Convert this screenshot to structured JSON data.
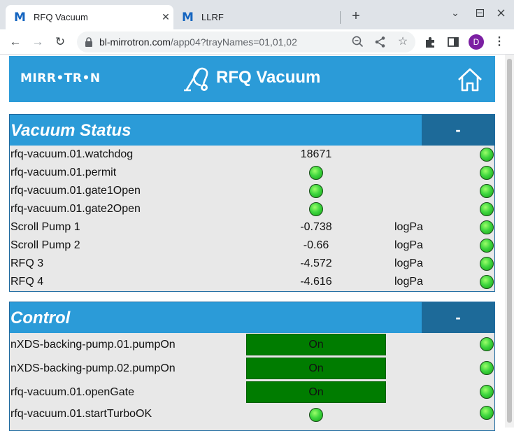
{
  "browser": {
    "tabs": [
      {
        "icon": "M",
        "title": "RFQ Vacuum",
        "active": true,
        "close": "✕"
      },
      {
        "icon": "M",
        "title": "LLRF",
        "active": false,
        "close": ""
      }
    ],
    "new_tab": "+",
    "url_host": "bl-mirrotron.com",
    "url_path": "/app04?trayNames=01,01,02",
    "profile_initial": "D"
  },
  "header": {
    "logo": "MIRR•TR•N",
    "title": "RFQ Vacuum"
  },
  "vacuum_status": {
    "title": "Vacuum Status",
    "toggle": "-",
    "rows": [
      {
        "label": "rfq-vacuum.01.watchdog",
        "value": "18671",
        "unit": ""
      },
      {
        "label": "rfq-vacuum.01.permit",
        "value": "",
        "unit": ""
      },
      {
        "label": "rfq-vacuum.01.gate1Open",
        "value": "",
        "unit": ""
      },
      {
        "label": "rfq-vacuum.01.gate2Open",
        "value": "",
        "unit": ""
      },
      {
        "label": "Scroll Pump 1",
        "value": "-0.738",
        "unit": "logPa"
      },
      {
        "label": "Scroll Pump 2",
        "value": "-0.66",
        "unit": "logPa"
      },
      {
        "label": "RFQ 3",
        "value": "-4.572",
        "unit": "logPa"
      },
      {
        "label": "RFQ 4",
        "value": "-4.616",
        "unit": "logPa"
      }
    ]
  },
  "control": {
    "title": "Control",
    "toggle": "-",
    "rows": [
      {
        "label": "nXDS-backing-pump.01.pumpOn",
        "button": "On"
      },
      {
        "label": "nXDS-backing-pump.02.pumpOn",
        "button": "On"
      },
      {
        "label": "rfq-vacuum.01.openGate",
        "button": "On"
      },
      {
        "label": "rfq-vacuum.01.startTurboOK",
        "button": ""
      }
    ]
  },
  "colors": {
    "accent": "#2b9bd8",
    "toggle_bg": "#1d6a99",
    "led_green": "#3fd63f",
    "on_button": "#007c00"
  }
}
